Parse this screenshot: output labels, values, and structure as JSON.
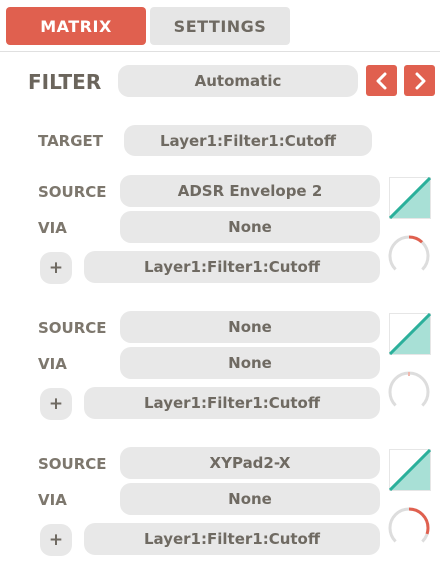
{
  "tabs": [
    {
      "label": "MATRIX",
      "active": true
    },
    {
      "label": "SETTINGS",
      "active": false
    }
  ],
  "filter": {
    "label": "FILTER",
    "value": "Automatic",
    "prev_icon": "chevron-left-icon",
    "next_icon": "chevron-right-icon"
  },
  "target": {
    "label": "TARGET",
    "value": "Layer1:Filter1:Cutoff"
  },
  "routings": [
    {
      "source_label": "SOURCE",
      "source_value": "ADSR Envelope 2",
      "via_label": "VIA",
      "via_value": "None",
      "plus_label": "+",
      "dest_value": "Layer1:Filter1:Cutoff",
      "curve_icon": "linear-curve-icon",
      "amount": 0.12
    },
    {
      "source_label": "SOURCE",
      "source_value": "None",
      "via_label": "VIA",
      "via_value": "None",
      "plus_label": "+",
      "dest_value": "Layer1:Filter1:Cutoff",
      "curve_icon": "linear-curve-icon",
      "amount": 0.0
    },
    {
      "source_label": "SOURCE",
      "source_value": "XYPad2-X",
      "via_label": "VIA",
      "via_value": "None",
      "plus_label": "+",
      "dest_value": "Layer1:Filter1:Cutoff",
      "curve_icon": "linear-curve-icon",
      "amount": 0.3
    }
  ],
  "colors": {
    "accent": "#e0604f",
    "pill": "#e8e8e8",
    "curve_fill": "#a8e0d6",
    "curve_line": "#2bb09b",
    "knob_track": "#dddddd"
  }
}
